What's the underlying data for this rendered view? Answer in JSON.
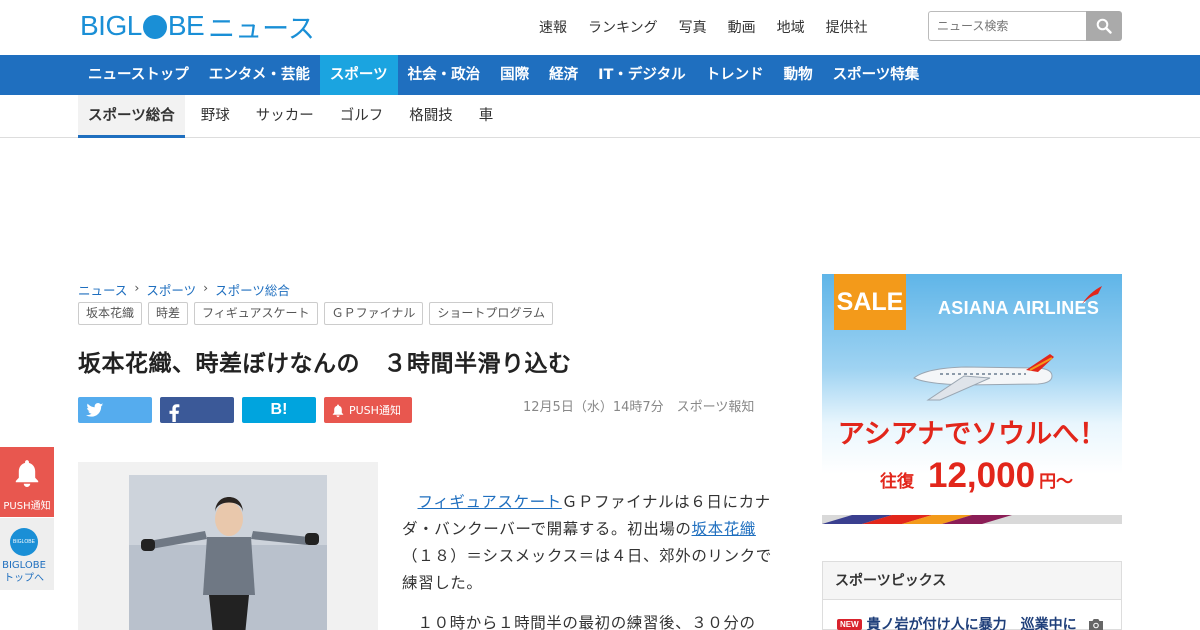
{
  "header": {
    "logo_biglobe_a": "BIGL",
    "logo_biglobe_b": "BE",
    "logo_news": "ニュース",
    "top_links": [
      "速報",
      "ランキング",
      "写真",
      "動画",
      "地域",
      "提供社"
    ],
    "search_placeholder": "ニュース検索"
  },
  "category_nav": {
    "items": [
      "ニューストップ",
      "エンタメ・芸能",
      "スポーツ",
      "社会・政治",
      "国際",
      "経済",
      "IT・デジタル",
      "トレンド",
      "動物",
      "スポーツ特集"
    ],
    "active": "スポーツ"
  },
  "sub_nav": {
    "items": [
      "スポーツ総合",
      "野球",
      "サッカー",
      "ゴルフ",
      "格闘技",
      "車"
    ],
    "active": "スポーツ総合"
  },
  "breadcrumb": [
    "ニュース",
    "スポーツ",
    "スポーツ総合"
  ],
  "tags": [
    "坂本花織",
    "時差",
    "フィギュアスケート",
    "ＧＰファイナル",
    "ショートプログラム"
  ],
  "article": {
    "title": "坂本花織、時差ぼけなんの　３時間半滑り込む",
    "date": "12月5日（水）14時7分",
    "source": "スポーツ報知",
    "push_label": "PUSH通知",
    "hatena_label": "B!",
    "p1_link1": "フィギュアスケート",
    "p1_text1": "ＧＰファイナルは６日にカナダ・バンクーバーで開幕する。初出場の",
    "p1_link2": "坂本花織",
    "p1_text2": "（１８）＝シスメックス＝は４日、郊外のリンクで練習した。",
    "p2_text": "１０時から１時間半の最初の練習後、３０分の"
  },
  "ad": {
    "sale": "SALE",
    "brand": "ASIANA AIRLINES",
    "copy": "アシアナでソウルへ！",
    "price_prefix": "往復",
    "price": "12,000",
    "price_suffix": "円〜"
  },
  "topics": {
    "heading": "スポーツピックス",
    "new_badge": "NEW",
    "item1": "貴ノ岩が付け人に暴力　巡業中に"
  },
  "floating": {
    "push_label": "PUSH通知",
    "biglobe_circle": "BIGLOBE",
    "top_label_1": "BIGLOBE",
    "top_label_2": "トップへ"
  },
  "colors": {
    "brand_blue": "#1a8fd6",
    "nav_blue": "#1f6fbf",
    "nav_active": "#1ba4e0",
    "push_red": "#e8574f"
  }
}
